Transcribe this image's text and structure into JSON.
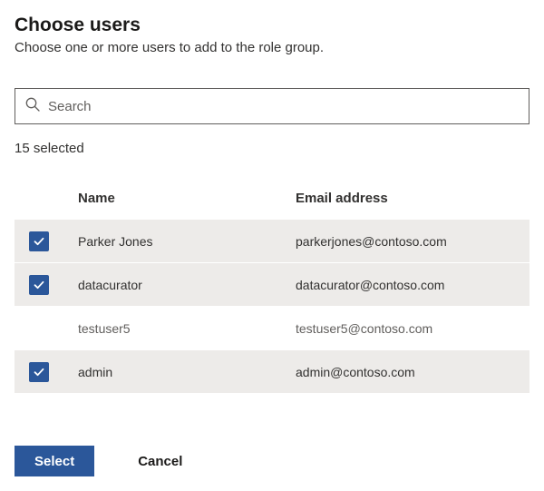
{
  "header": {
    "title": "Choose users",
    "subtitle": "Choose one or more users to add to the role group."
  },
  "search": {
    "placeholder": "Search"
  },
  "selection": {
    "count_label": "15 selected"
  },
  "columns": {
    "name": "Name",
    "email": "Email address"
  },
  "rows": [
    {
      "name": "Parker Jones",
      "email": "parkerjones@contoso.com",
      "selected": true
    },
    {
      "name": "datacurator",
      "email": "datacurator@contoso.com",
      "selected": true
    },
    {
      "name": "testuser5",
      "email": "testuser5@contoso.com",
      "selected": false
    },
    {
      "name": "admin",
      "email": "admin@contoso.com",
      "selected": true
    }
  ],
  "footer": {
    "select_label": "Select",
    "cancel_label": "Cancel"
  }
}
